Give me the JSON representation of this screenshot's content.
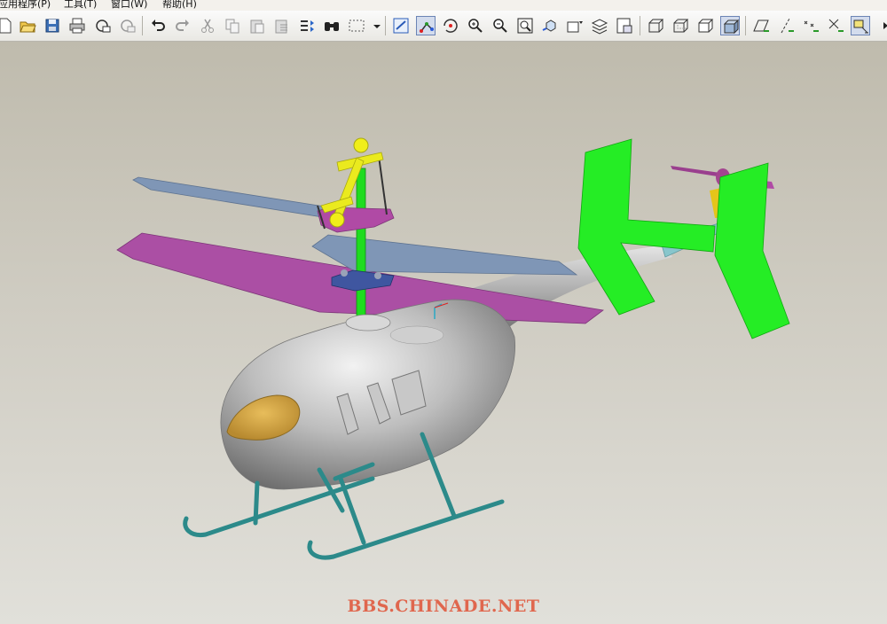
{
  "menu": {
    "items": [
      {
        "label": "应用程序(P)"
      },
      {
        "label": "工具(T)"
      },
      {
        "label": "窗口(W)"
      },
      {
        "label": "帮助(H)"
      }
    ]
  },
  "toolbar": {
    "buttons": [
      {
        "icon": "new-file-icon"
      },
      {
        "icon": "open-folder-icon"
      },
      {
        "icon": "save-icon"
      },
      {
        "icon": "print-icon"
      },
      {
        "icon": "send-mail-icon"
      },
      {
        "icon": "send-mail-disabled-icon"
      },
      {
        "icon": "undo-icon"
      },
      {
        "icon": "redo-icon"
      },
      {
        "icon": "cut-icon"
      },
      {
        "icon": "copy-icon"
      },
      {
        "icon": "paste-icon"
      },
      {
        "icon": "paste-special-icon"
      },
      {
        "icon": "regenerate-icon"
      },
      {
        "icon": "find-binoculars-icon"
      },
      {
        "icon": "selection-box-icon"
      },
      {
        "icon": "dropdown-arrow-icon"
      },
      {
        "icon": "repaint-icon"
      },
      {
        "icon": "spin-center-icon",
        "active": true
      },
      {
        "icon": "orient-mode-icon"
      },
      {
        "icon": "zoom-in-icon"
      },
      {
        "icon": "zoom-out-icon"
      },
      {
        "icon": "refit-icon"
      },
      {
        "icon": "reorient-icon"
      },
      {
        "icon": "saved-views-icon"
      },
      {
        "icon": "layers-icon"
      },
      {
        "icon": "view-manager-icon"
      },
      {
        "icon": "wireframe-icon"
      },
      {
        "icon": "hidden-line-icon"
      },
      {
        "icon": "no-hidden-icon"
      },
      {
        "icon": "shading-icon",
        "active": true
      },
      {
        "icon": "datum-planes-icon"
      },
      {
        "icon": "datum-axes-icon"
      },
      {
        "icon": "datum-points-icon"
      },
      {
        "icon": "coordinate-systems-icon"
      },
      {
        "icon": "annotations-icon",
        "active": true
      },
      {
        "icon": "more-arrow-icon"
      }
    ]
  },
  "viewport": {
    "model": "helicopter-assembly",
    "colors": {
      "fuselage": "#c2c2c2",
      "canopy": "#d4a84a",
      "main_blade_a": "#a94fa4",
      "main_blade_b": "#7e95b5",
      "tail_fins": "#22ee22",
      "skids": "#2c8a8a",
      "linkage_yellow": "#eaea1e",
      "rotor_shaft": "#1fdc1f"
    }
  },
  "watermark": "BBS.CHINADE.NET"
}
